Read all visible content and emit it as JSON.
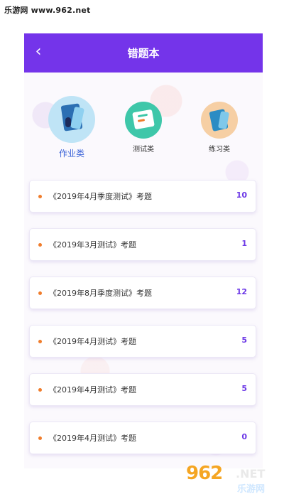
{
  "watermark_top": "乐游网 www.962.net",
  "header": {
    "title": "错题本",
    "back_icon": "chevron-left-icon"
  },
  "categories": [
    {
      "label": "作业类",
      "active": true,
      "icon": "homework-books-icon",
      "color": "#bfe4f6"
    },
    {
      "label": "测试类",
      "active": false,
      "icon": "test-notebook-icon",
      "color": "#3ec7a9"
    },
    {
      "label": "练习类",
      "active": false,
      "icon": "practice-books-icon",
      "color": "#f6cfa4"
    }
  ],
  "items": [
    {
      "title": "《2019年4月季度测试》考题",
      "count": "10"
    },
    {
      "title": "《2019年3月测试》考题",
      "count": "1"
    },
    {
      "title": "《2019年8月季度测试》考题",
      "count": "12"
    },
    {
      "title": "《2019年4月测试》考题",
      "count": "5"
    },
    {
      "title": "《2019年4月测试》考题",
      "count": "5"
    },
    {
      "title": "《2019年4月测试》考题",
      "count": "0"
    }
  ],
  "watermark_bottom": {
    "num": "962",
    "net": ".NET",
    "cn": "乐游网"
  },
  "colors": {
    "accent": "#7434ea",
    "dot": "#f07d2c",
    "count": "#6c38e6"
  }
}
